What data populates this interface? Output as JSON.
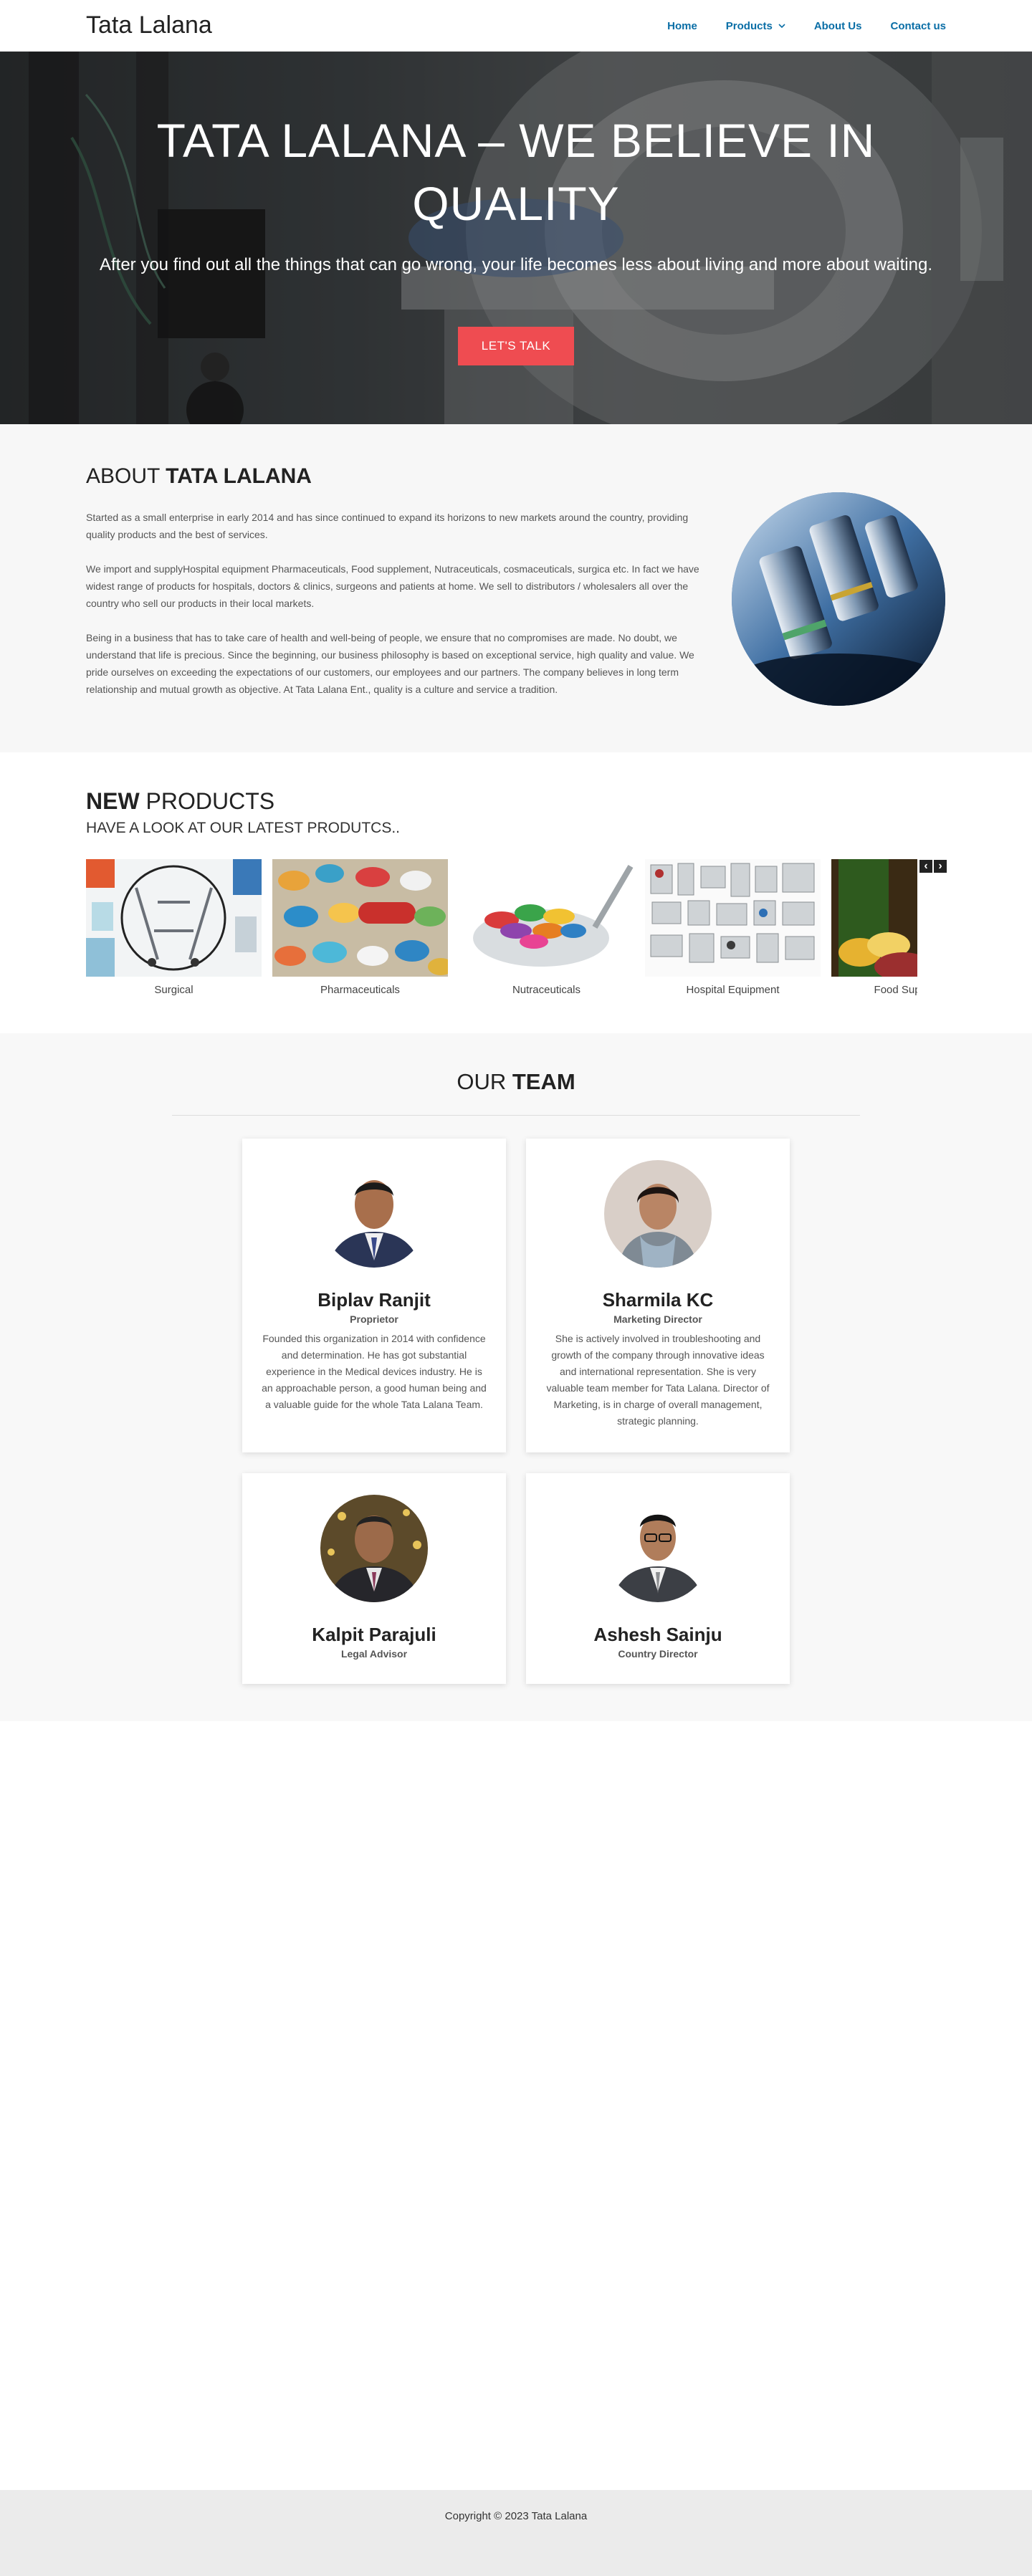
{
  "header": {
    "brand": "Tata Lalana",
    "nav": [
      {
        "label": "Home"
      },
      {
        "label": "Products"
      },
      {
        "label": "About Us"
      },
      {
        "label": "Contact us"
      }
    ]
  },
  "hero": {
    "title": "TATA LALANA – WE BELIEVE IN QUALITY",
    "subtitle": "After you find out all the things that can go wrong, your life becomes less about living and more about waiting.",
    "button_label": "LET'S TALK",
    "button_color": "#ef4c51"
  },
  "about": {
    "heading_light": "ABOUT ",
    "heading_bold": "TATA LALANA",
    "paragraphs": [
      "Started as a small enterprise in early 2014 and has since continued to expand its horizons to new markets around the country, providing quality products and the best of services.",
      "We import and supplyHospital equipment Pharmaceuticals, Food supplement, Nutraceuticals, cosmaceuticals, surgica etc. In fact we have widest range of products for hospitals, doctors & clinics, surgeons and patients at home. We sell to distributors / wholesalers all over the country who sell our products in their local markets.",
      "Being in a business that has to take care of health and well-being of people, we ensure that no compromises are made. No doubt, we understand that life is precious. Since the beginning, our business philosophy is based on exceptional service, high quality and value. We pride ourselves on exceeding the expectations of our customers, our employees and our partners. The company believes in long term relationship and mutual growth as objective. At Tata Lalana Ent., quality is a culture and service a tradition."
    ]
  },
  "products": {
    "heading_bold": "NEW",
    "heading_light": " PRODUCTS",
    "subheading": "HAVE A LOOK AT OUR LATEST PRODUTCS..",
    "items": [
      {
        "label": "Surgical"
      },
      {
        "label": "Pharmaceuticals"
      },
      {
        "label": "Nutraceuticals"
      },
      {
        "label": "Hospital Equipment"
      },
      {
        "label": "Food Supplements"
      }
    ],
    "prev_icon": "‹",
    "next_icon": "›"
  },
  "team": {
    "heading_light": "OUR ",
    "heading_bold": "TEAM",
    "members": [
      {
        "name": "Biplav Ranjit",
        "role": "Proprietor",
        "description": "Founded this organization in 2014 with confidence and determination. He has got substantial experience in the Medical devices industry. He is an approachable person, a good human being and a valuable guide for the whole Tata Lalana Team."
      },
      {
        "name": "Sharmila KC",
        "role": "Marketing Director",
        "description": "She is actively involved in troubleshooting and growth of the company through innovative ideas and international representation. She is very valuable team member for Tata Lalana. Director of Marketing, is in charge of overall management, strategic planning."
      },
      {
        "name": "Kalpit Parajuli",
        "role": "Legal Advisor",
        "description": ""
      },
      {
        "name": "Ashesh Sainju",
        "role": "Country Director",
        "description": ""
      }
    ]
  },
  "footer": {
    "copyright": "Copyright © 2023 Tata Lalana"
  },
  "colors": {
    "accent": "#ef4c51",
    "nav_link": "#0a6ea6"
  }
}
